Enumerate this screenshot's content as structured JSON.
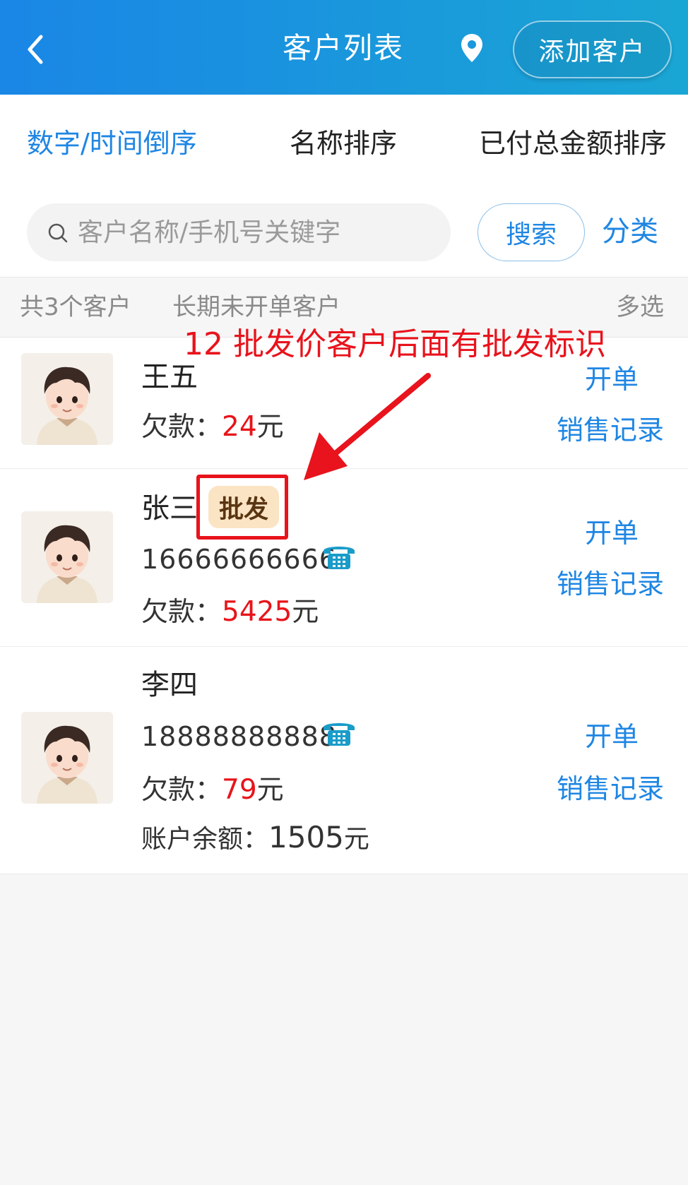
{
  "header": {
    "title": "客户列表",
    "add_button": "添加客户"
  },
  "sort_tabs": [
    {
      "label": "数字/时间倒序",
      "active": true
    },
    {
      "label": "名称排序",
      "active": false
    },
    {
      "label": "已付总金额排序",
      "active": false
    }
  ],
  "search": {
    "placeholder": "客户名称/手机号关键字",
    "value": "",
    "button": "搜索",
    "classify": "分类"
  },
  "info_bar": {
    "count": "共3个客户",
    "long_inactive": "长期未开单客户",
    "multi_select": "多选"
  },
  "annotation": {
    "text": "12 批发价客户后面有批发标识"
  },
  "customers": [
    {
      "name": "王五",
      "debt_label": "欠款：",
      "debt_amount": "24",
      "unit": "元",
      "open_order": "开单",
      "sales_record": "销售记录"
    },
    {
      "name": "张三",
      "badge": "批发",
      "phone": "16666666666",
      "debt_label": "欠款：",
      "debt_amount": "5425",
      "unit": "元",
      "open_order": "开单",
      "sales_record": "销售记录"
    },
    {
      "name": "李四",
      "phone": "18888888888",
      "debt_label": "欠款：",
      "debt_amount": "79",
      "unit": "元",
      "balance_label": "账户余额：",
      "balance_amount": "1505",
      "open_order": "开单",
      "sales_record": "销售记录"
    }
  ],
  "colors": {
    "header_start": "#1a86e6",
    "header_end": "#1aa6d4",
    "link_blue": "#1f86e3",
    "debt_red": "#e8141a",
    "badge_bg": "#fbe4c4",
    "annotation_red": "#e8131c"
  },
  "icons": [
    "back-arrow-icon",
    "location-pin-icon",
    "search-icon",
    "telephone-icon",
    "avatar-boy-icon"
  ]
}
